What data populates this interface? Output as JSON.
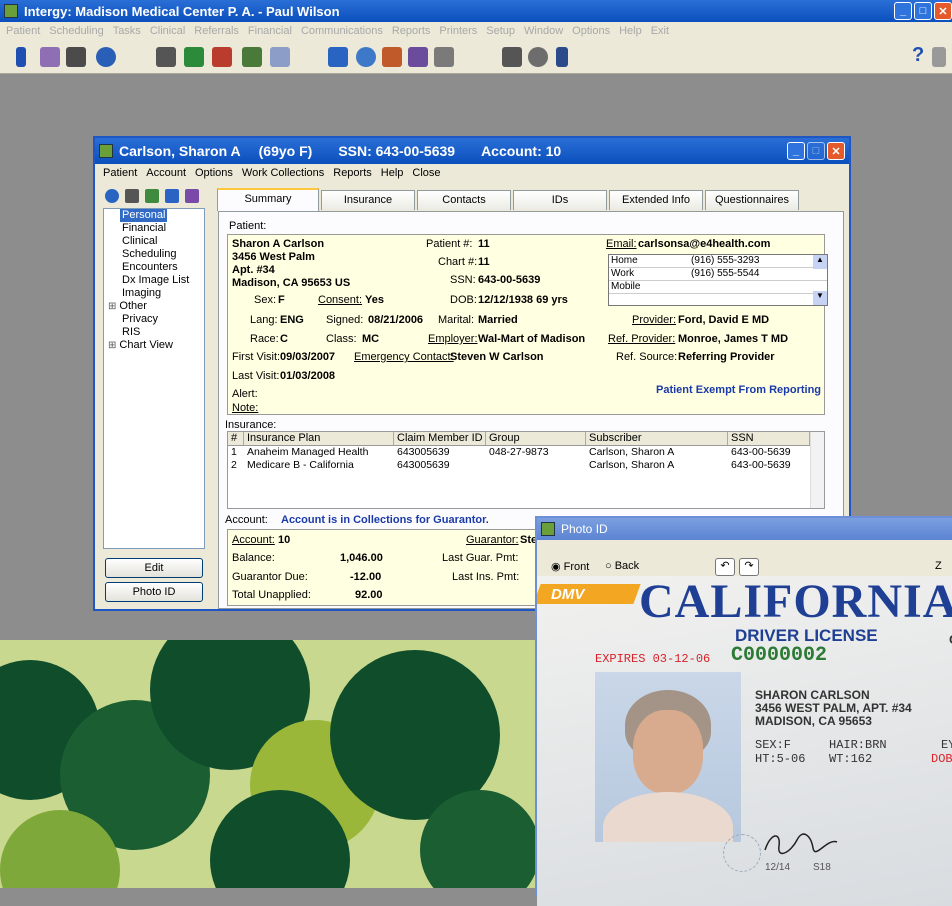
{
  "app": {
    "title": "Intergy: Madison Medical Center P. A. - Paul Wilson",
    "menu": [
      "Patient",
      "Scheduling",
      "Tasks",
      "Clinical",
      "Referrals",
      "Financial",
      "Communications",
      "Reports",
      "Printers",
      "Setup",
      "Window",
      "Options",
      "Help",
      "Exit"
    ],
    "help_glyph": "?"
  },
  "patient_window": {
    "name": "Carlson, Sharon A",
    "age": "(69yo F)",
    "ssn_header": "SSN: 643-00-5639",
    "account_header": "Account: 10",
    "menu": [
      "Patient",
      "Account",
      "Options",
      "Work Collections",
      "Reports",
      "Help",
      "Close"
    ],
    "tree": [
      "Personal",
      "Financial",
      "Clinical",
      "Scheduling",
      "Encounters",
      "Dx Image List",
      "Imaging",
      "Other",
      "Privacy",
      "RIS",
      "Chart View"
    ],
    "edit_button": "Edit",
    "photo_button": "Photo ID",
    "tabs": [
      "Summary",
      "Insurance",
      "Contacts",
      "IDs",
      "Extended Info",
      "Questionnaires"
    ]
  },
  "patient": {
    "section": "Patient:",
    "name": "Sharon A Carlson",
    "addr1": "3456 West Palm",
    "addr2": "Apt. #34",
    "city": "Madison, CA  95653  US",
    "patient_no_label": "Patient #:",
    "patient_no": "11",
    "chart_no_label": "Chart #:",
    "chart_no": "11",
    "ssn_label": "SSN:",
    "ssn": "643-00-5639",
    "dob_label": "DOB:",
    "dob": "12/12/1938  69 yrs",
    "email_label": "Email:",
    "email": "carlsonsa@e4health.com",
    "phones": [
      {
        "type": "Home",
        "num": "(916) 555-3293"
      },
      {
        "type": "Work",
        "num": "(916) 555-5544"
      },
      {
        "type": "Mobile",
        "num": ""
      }
    ],
    "sex_label": "Sex:",
    "sex": "F",
    "consent_label": "Consent:",
    "consent": "Yes",
    "lang_label": "Lang:",
    "lang": "ENG",
    "signed_label": "Signed:",
    "signed": "08/21/2006",
    "marital_label": "Marital:",
    "marital": "Married",
    "provider_label": "Provider:",
    "provider": "Ford, David E MD",
    "race_label": "Race:",
    "race": "C",
    "class_label": "Class:",
    "class": "MC",
    "employer_label": "Employer:",
    "employer": "Wal-Mart of Madison",
    "ref_provider_label": "Ref. Provider:",
    "ref_provider": "Monroe, James T MD",
    "first_visit_label": "First Visit:",
    "first_visit": "09/03/2007",
    "emergency_label": "Emergency Contact:",
    "emergency": "Steven W Carlson",
    "ref_source_label": "Ref. Source:",
    "ref_source": "Referring Provider",
    "last_visit_label": "Last Visit:",
    "last_visit": "01/03/2008",
    "exempt": "Patient Exempt From Reporting",
    "alert_label": "Alert:",
    "note_label": "Note:"
  },
  "insurance": {
    "section": "Insurance:",
    "headers": [
      "#",
      "Insurance Plan",
      "Claim Member ID",
      "Group",
      "Subscriber",
      "SSN"
    ],
    "rows": [
      [
        "1",
        "Anaheim Managed Health",
        "643005639",
        "048-27-9873",
        "Carlson, Sharon A",
        "643-00-5639"
      ],
      [
        "2",
        "Medicare B - California",
        "643005639",
        "",
        "Carlson, Sharon A",
        "643-00-5639"
      ]
    ]
  },
  "account": {
    "section": "Account:",
    "status": "Account is in Collections for Guarantor.",
    "account_label": "Account:",
    "account_no": "10",
    "guarantor_label": "Guarantor:",
    "guarantor": "Ste",
    "balance_label": "Balance:",
    "balance": "1,046.00",
    "last_guar_label": "Last Guar. Pmt:",
    "guar_due_label": "Guarantor Due:",
    "guar_due": "-12.00",
    "last_ins_label": "Last Ins. Pmt:",
    "unapplied_label": "Total Unapplied:",
    "unapplied": "92.00"
  },
  "photo_window": {
    "title": "Photo ID",
    "front": "Front",
    "back": "Back",
    "zoom_partial": "Z",
    "license": {
      "dmv": "DMV",
      "state": "CALIFORNIA",
      "kind": "DRIVER LICENSE",
      "expires": "EXPIRES 03-12-06",
      "number": "C0000002",
      "name": "SHARON CARLSON",
      "addr1": "3456 WEST PALM, APT. #34",
      "addr2": "MADISON, CA 95653",
      "sex": "SEX:F",
      "hair": "HAIR:BRN",
      "ht": "HT:5-06",
      "wt": "WT:162",
      "dob_partial": "DOB:",
      "eye_partial": "EY",
      "c_partial": "C",
      "footer1": "12/14",
      "footer2": "S18"
    }
  },
  "colors": {
    "title_blue": "#0b4fbd",
    "panel_yellow": "#ffffe1",
    "license_red": "#d8232a",
    "license_blue": "#1f3f94",
    "license_green": "#2c7a35"
  }
}
